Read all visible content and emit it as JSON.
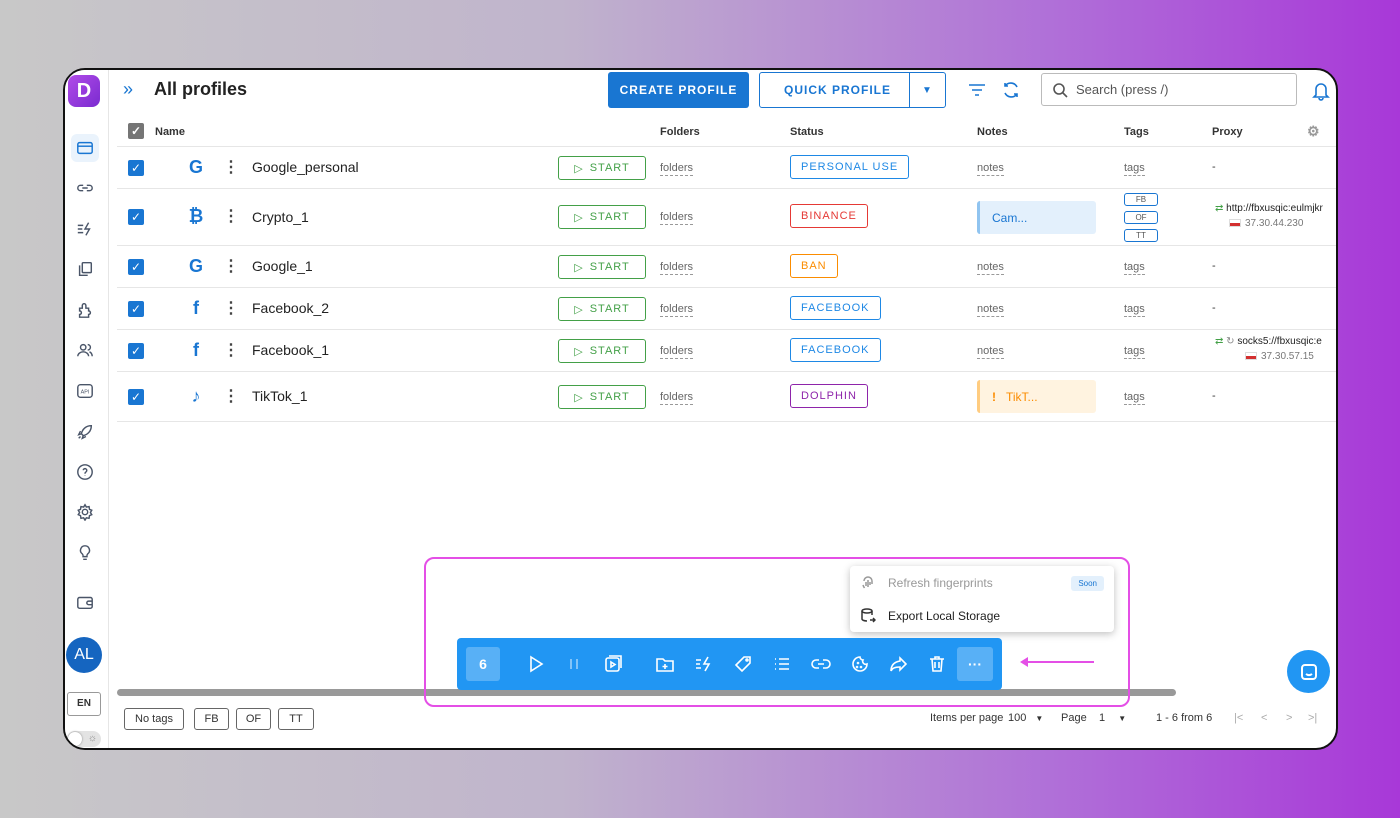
{
  "header": {
    "title": "All profiles",
    "create_label": "CREATE PROFILE",
    "quick_label": "QUICK PROFILE",
    "search_placeholder": "Search (press /)"
  },
  "sidebar": {
    "avatar": "AL",
    "language": "EN"
  },
  "table": {
    "columns": {
      "name": "Name",
      "folders": "Folders",
      "status": "Status",
      "notes": "Notes",
      "tags": "Tags",
      "proxy": "Proxy"
    },
    "start_label": "START",
    "folders_label": "folders",
    "notes_label": "notes",
    "tags_label": "tags",
    "no_proxy": "-",
    "rows": [
      {
        "name": "Google_personal",
        "status": "PERSONAL USE",
        "status_color": "#1e88e5"
      },
      {
        "name": "Crypto_1",
        "status": "BINANCE",
        "status_color": "#e53935",
        "note": "Cam...",
        "tags": [
          "FB",
          "OF",
          "TT"
        ],
        "proxy": "http://fbxusqic:eulmjkr",
        "proxy_ip": "37.30.44.230"
      },
      {
        "name": "Google_1",
        "status": "BAN",
        "status_color": "#fb8c00"
      },
      {
        "name": "Facebook_2",
        "status": "FACEBOOK",
        "status_color": "#1e88e5"
      },
      {
        "name": "Facebook_1",
        "status": "FACEBOOK",
        "status_color": "#1e88e5",
        "proxy": "socks5://fbxusqic:e",
        "proxy_ip": "37.30.57.15"
      },
      {
        "name": "TikTok_1",
        "status": "DOLPHIN",
        "status_color": "#8e24aa",
        "note": "TikT..."
      }
    ]
  },
  "footer": {
    "chips": [
      "No tags",
      "FB",
      "OF",
      "TT"
    ],
    "items_per_page_label": "Items per page",
    "items_per_page": "100",
    "page_label": "Page",
    "page": "1",
    "range": "1 - 6 from 6"
  },
  "menu": {
    "refresh_label": "Refresh fingerprints",
    "soon_label": "Soon",
    "export_label": "Export Local Storage"
  },
  "action_bar": {
    "selected_count": "6",
    "more_label": "···"
  },
  "colors": {
    "primary": "#1976d2",
    "start_green": "#43a047",
    "highlight": "#e44fe6"
  }
}
